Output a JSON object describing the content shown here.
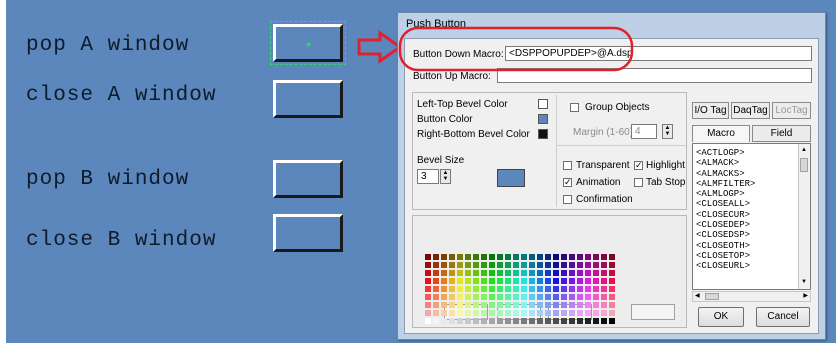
{
  "screen": {
    "labels": [
      "pop A window",
      "close A window",
      "pop B window",
      "close B window"
    ]
  },
  "dialog": {
    "title": "Push Button",
    "down_label": "Button Down Macro:",
    "down_value": "<DSPPOPUPDEP>@A.dsp",
    "up_label": "Button Up Macro:",
    "up_value": "",
    "left_top_bevel": "Left-Top Bevel Color",
    "button_color": "Button Color",
    "right_bottom_bevel": "Right-Bottom Bevel Color",
    "group_objects": "Group Objects",
    "margin_label": "Margin (1-60):",
    "margin_value": "4",
    "bevel_size_label": "Bevel Size",
    "bevel_size_value": "3",
    "transparent": "Transparent",
    "highlight": "Highlight",
    "animation": "Animation",
    "tab_stop": "Tab Stop",
    "confirmation": "Confirmation",
    "tabs": [
      "I/O Tag",
      "DaqTag",
      "LocTag"
    ],
    "macro_btn": "Macro",
    "field_btn": "Field",
    "macros": [
      "<ACTLOGP>",
      "<ALMACK>",
      "<ALMACKS>",
      "<ALMFILTER>",
      "<ALMLOGP>",
      "<CLOSEALL>",
      "<CLOSECUR>",
      "<CLOSEDEP>",
      "<CLOSEDSP>",
      "<CLOSEOTH>",
      "<CLOSETOP>",
      "<CLOSEURL>"
    ],
    "ok": "OK",
    "cancel": "Cancel"
  },
  "colors": {
    "canvas": "#5b87bd",
    "annotation": "#e0202a",
    "selection": "#2bd66b"
  }
}
